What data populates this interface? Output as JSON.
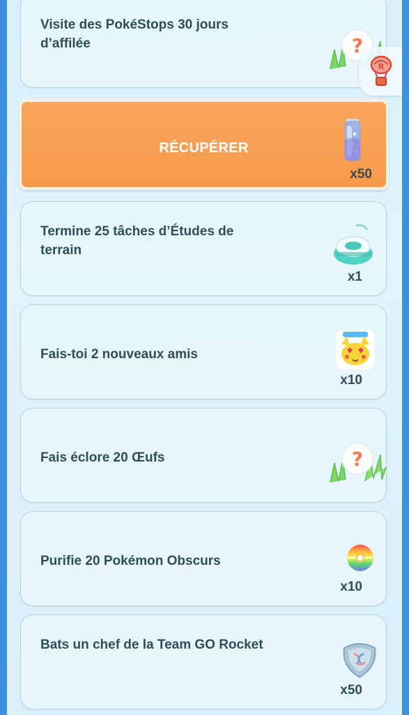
{
  "quests": {
    "item1": {
      "label": "Visite des PokéStops 30 jours d’affilée",
      "reward_icon": "mystery-reward-icon"
    },
    "claim": {
      "label": "RÉCUPÉRER",
      "quantity": "x50",
      "reward_icon": "stardust-icon"
    },
    "item3": {
      "label": "Termine 25 tâches d’Études de terrain",
      "quantity": "x1",
      "reward_icon": "incense-icon"
    },
    "item4": {
      "label": "Fais-toi 2 nouveaux amis",
      "quantity": "x10",
      "reward_icon": "pikachu-sticker-icon"
    },
    "item5": {
      "label": "Fais éclore 20 Œufs",
      "reward_icon": "mystery-reward-icon"
    },
    "item6": {
      "label": "Purifie 20 Pokémon Obscurs",
      "quantity": "x10",
      "reward_icon": "rainbow-ball-icon"
    },
    "item7": {
      "label": "Bats un chef de la Team GO Rocket",
      "quantity": "x50",
      "reward_icon": "tm-icon"
    }
  },
  "side_tab": {
    "icon": "team-rocket-balloon-icon"
  },
  "colors": {
    "background_frame": "#3f8fe0",
    "claim_orange": "#f89a4b",
    "text": "#2e4f55"
  }
}
